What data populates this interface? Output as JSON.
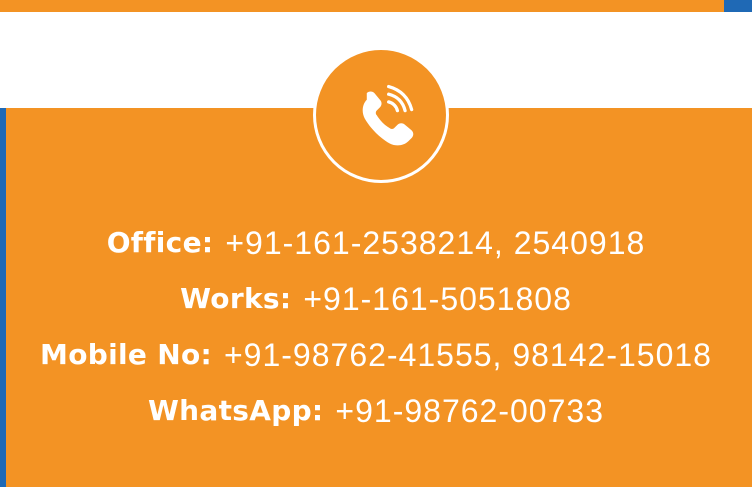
{
  "colors": {
    "brand_orange": "#f39324",
    "brand_blue": "#1f69b5",
    "text": "#ffffff"
  },
  "icon": {
    "name": "phone-icon"
  },
  "contacts": [
    {
      "label": "Office:",
      "value": "+91-161-2538214, 2540918"
    },
    {
      "label": "Works:",
      "value": "+91-161-5051808"
    },
    {
      "label": "Mobile No:",
      "value": "+91-98762-41555, 98142-15018"
    },
    {
      "label": "WhatsApp:",
      "value": "+91-98762-00733"
    }
  ]
}
